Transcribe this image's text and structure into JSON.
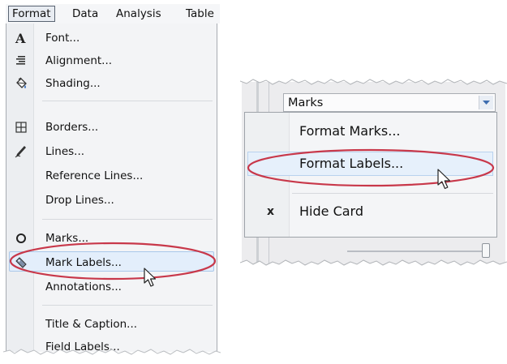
{
  "menubar": {
    "items": [
      "Format",
      "Data",
      "Analysis",
      "Table"
    ]
  },
  "format_menu": {
    "items": [
      {
        "label": "Font...",
        "icon": "font-icon"
      },
      {
        "label": "Alignment...",
        "icon": "alignment-icon"
      },
      {
        "label": "Shading...",
        "icon": "paint-bucket-icon"
      },
      {
        "label": "Borders...",
        "icon": "borders-icon"
      },
      {
        "label": "Lines...",
        "icon": "pen-icon"
      },
      {
        "label": "Reference Lines...",
        "icon": ""
      },
      {
        "label": "Drop Lines...",
        "icon": ""
      },
      {
        "label": "Marks...",
        "icon": "circle-icon"
      },
      {
        "label": "Mark Labels...",
        "icon": "tag-icon"
      },
      {
        "label": "Annotations...",
        "icon": ""
      },
      {
        "label": "Title & Caption...",
        "icon": ""
      },
      {
        "label": "Field Labels...",
        "icon": ""
      }
    ],
    "highlighted": "Mark Labels..."
  },
  "marks_card": {
    "title": "Marks",
    "context_menu": {
      "items": [
        "Format Marks...",
        "Format Labels...",
        "Hide Card"
      ],
      "highlighted": "Format Labels...",
      "hide_icon": "x"
    }
  },
  "colors": {
    "annotation_ellipse": "#c8384a",
    "highlight": "#e3eefb"
  }
}
